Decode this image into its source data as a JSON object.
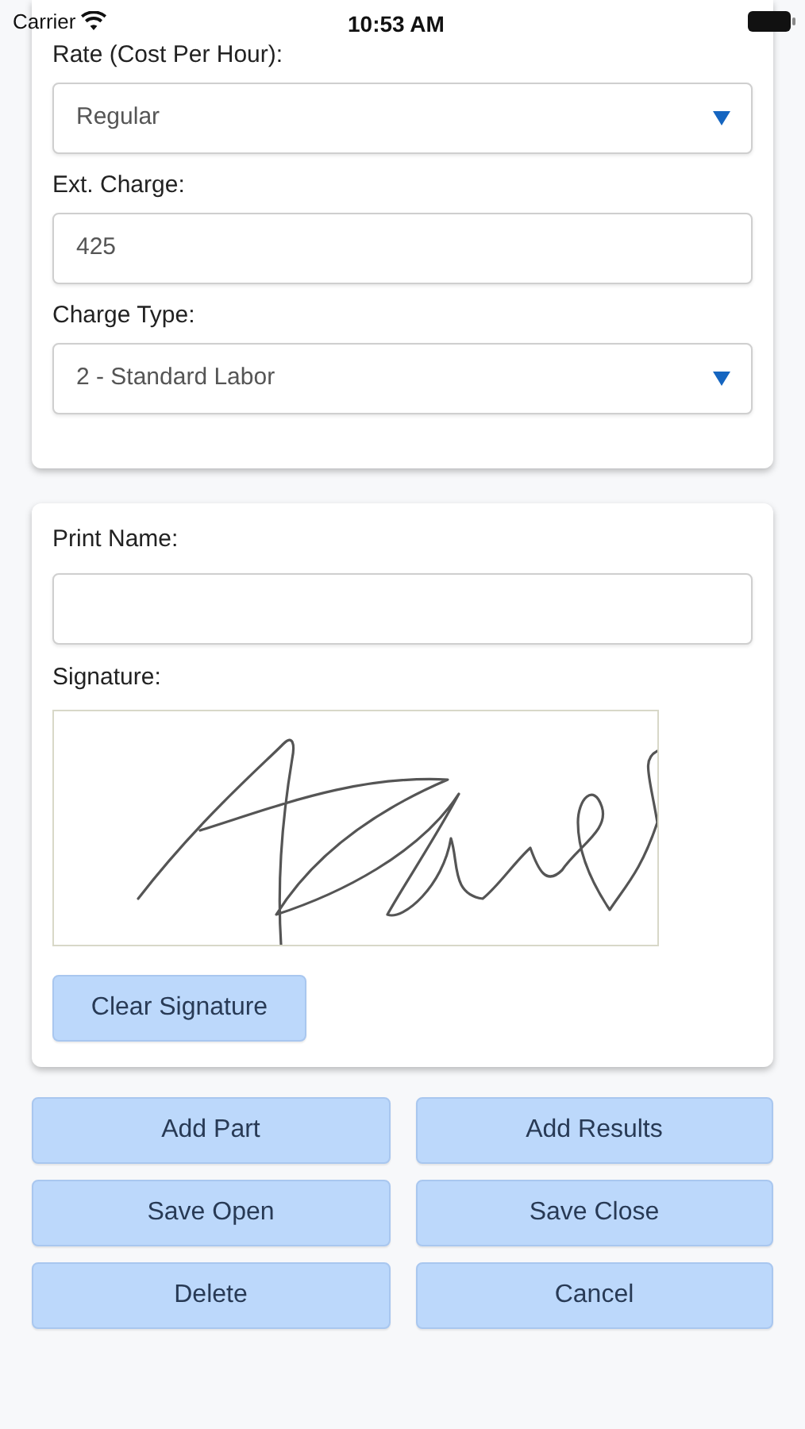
{
  "status_bar": {
    "carrier": "Carrier",
    "time": "10:53 AM"
  },
  "charge_card": {
    "fields": [
      {
        "label": "Rate (Cost Per Hour):",
        "kind": "select",
        "value": "Regular"
      },
      {
        "label": "Ext. Charge:",
        "kind": "text",
        "value": "425"
      },
      {
        "label": "Charge Type:",
        "kind": "select",
        "value": "2 - Standard Labor"
      }
    ]
  },
  "signature_card": {
    "print_name_label": "Print Name:",
    "signature_label": "Signature:",
    "clear_button": "Clear Signature"
  },
  "actions": [
    [
      "Add Part",
      "Add Results"
    ],
    [
      "Save Open",
      "Save Close"
    ],
    [
      "Delete",
      "Cancel"
    ]
  ]
}
